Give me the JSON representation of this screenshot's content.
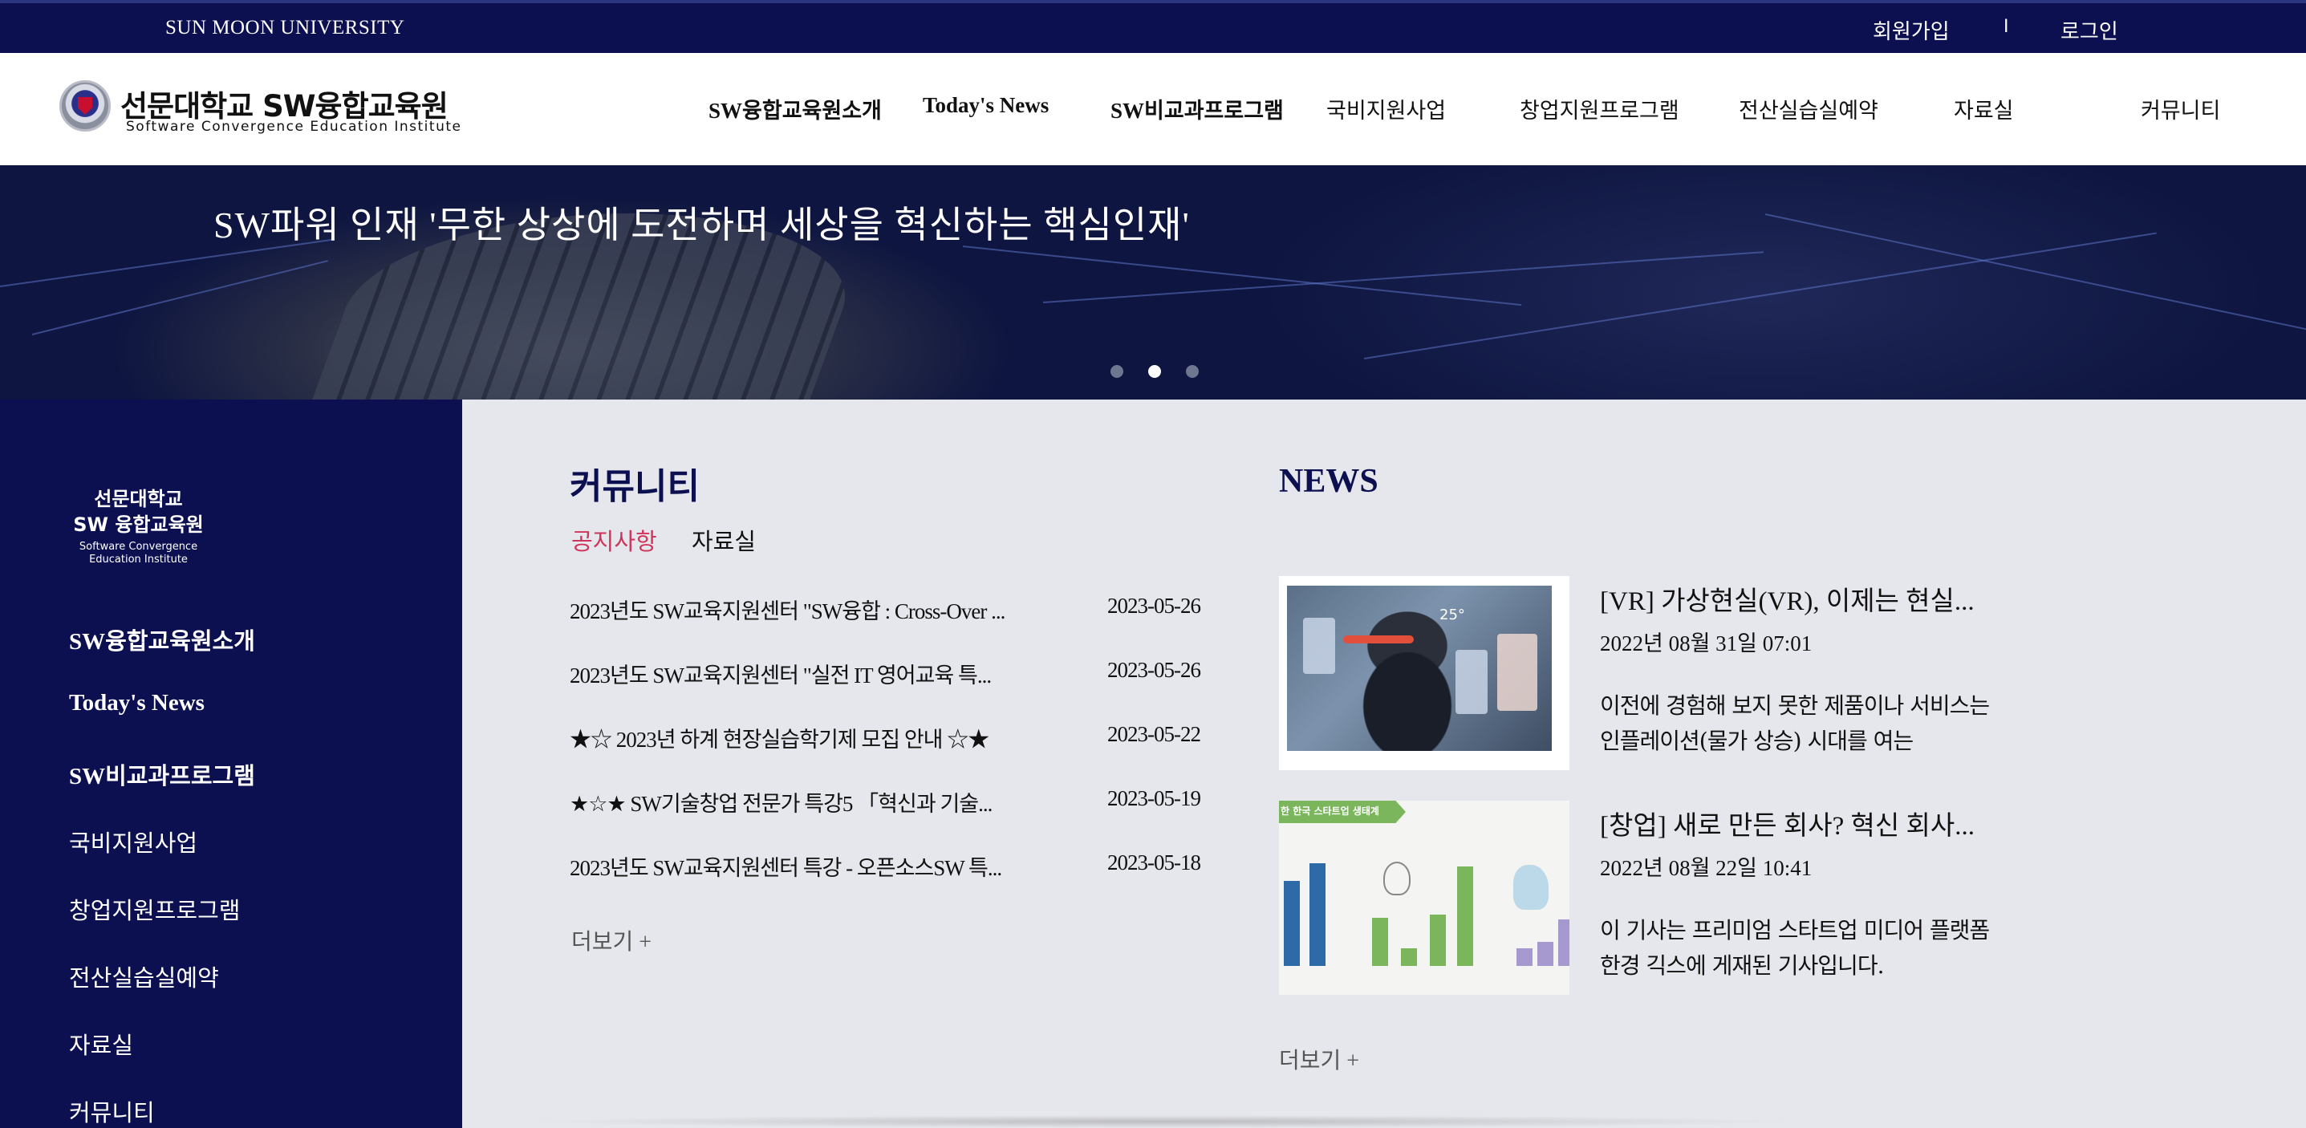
{
  "topbar": {
    "university": "SUN MOON UNIVERSITY",
    "signup": "회원가입",
    "separator": "I",
    "login": "로그인"
  },
  "header": {
    "logo_title": "선문대학교 SW융합교육원",
    "logo_subtitle": "Software Convergence Education Institute",
    "nav": [
      "SW융합교육원소개",
      "Today's News",
      "SW비교과프로그램",
      "국비지원사업",
      "창업지원프로그램",
      "전산실습실예약",
      "자료실",
      "커뮤니티"
    ]
  },
  "hero": {
    "headline": "SW파워 인재 '무한 상상에 도전하며 세상을 혁신하는 핵심인재'",
    "slide_count": 3,
    "active_slide": 2
  },
  "sidebar": {
    "logo_line1": "선문대학교",
    "logo_line2": "SW 융합교육원",
    "logo_line3": "Software Convergence",
    "logo_line4": "Education Institute",
    "items": [
      "SW융합교육원소개",
      "Today's News",
      "SW비교과프로그램",
      "국비지원사업",
      "창업지원프로그램",
      "전산실습실예약",
      "자료실",
      "커뮤니티"
    ]
  },
  "community": {
    "title": "커뮤니티",
    "tabs": [
      "공지사항",
      "자료실"
    ],
    "active_tab": 0,
    "notices": [
      {
        "title": "2023년도 SW교육지원센터 \"SW융합 : Cross-Over ...",
        "date": "2023-05-26"
      },
      {
        "title": "2023년도 SW교육지원센터 \"실전 IT 영어교육 특...",
        "date": "2023-05-26"
      },
      {
        "title": "★☆ 2023년 하계 현장실습학기제 모집 안내 ☆★",
        "date": "2023-05-22"
      },
      {
        "title": "★☆★ SW기술창업 전문가 특강5 「혁신과 기술...",
        "date": "2023-05-19"
      },
      {
        "title": "2023년도 SW교육지원센터 특강 - 오픈소스SW 특...",
        "date": "2023-05-18"
      }
    ],
    "more": "더보기 +"
  },
  "news": {
    "title": "NEWS",
    "items": [
      {
        "headline": "[VR] 가상현실(VR), 이제는 현실...",
        "date": "2022년 08월 31일 07:01",
        "body": "이전에 경험해 보지 못한 제품이나 서비스는 인플레이션(물가 상승) 시대를 여는",
        "thumb_temp": "25°"
      },
      {
        "headline": "[창업] 새로 만든 회사? 혁신 회사...",
        "date": "2022년 08월 22일 10:41",
        "body": "이 기사는 프리미엄 스타트업 미디어 플랫폼 한경 긱스에 게재된 기사입니다.",
        "thumb_ribbon": "한 한국 스타트업 생태계"
      }
    ],
    "more": "더보기 +"
  }
}
